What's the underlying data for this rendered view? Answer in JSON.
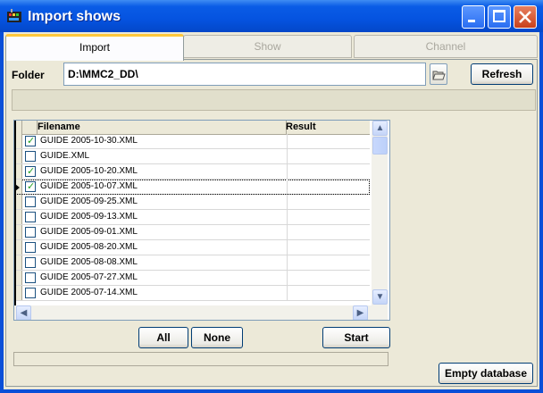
{
  "window": {
    "title": "Import shows"
  },
  "tabs": [
    {
      "label": "Import",
      "active": true
    },
    {
      "label": "Show",
      "active": false
    },
    {
      "label": "Channel",
      "active": false
    }
  ],
  "folder": {
    "label": "Folder",
    "value": "D:\\MMC2_DD\\",
    "refresh_label": "Refresh"
  },
  "grid": {
    "columns": [
      "Filename",
      "Result"
    ],
    "rows": [
      {
        "filename": "GUIDE 2005-10-30.XML",
        "checked": true,
        "result": ""
      },
      {
        "filename": "GUIDE.XML",
        "checked": false,
        "result": ""
      },
      {
        "filename": "GUIDE 2005-10-20.XML",
        "checked": true,
        "result": ""
      },
      {
        "filename": "GUIDE 2005-10-07.XML",
        "checked": true,
        "result": "",
        "current": true
      },
      {
        "filename": "GUIDE 2005-09-25.XML",
        "checked": false,
        "result": ""
      },
      {
        "filename": "GUIDE 2005-09-13.XML",
        "checked": false,
        "result": ""
      },
      {
        "filename": "GUIDE 2005-09-01.XML",
        "checked": false,
        "result": ""
      },
      {
        "filename": "GUIDE 2005-08-20.XML",
        "checked": false,
        "result": ""
      },
      {
        "filename": "GUIDE 2005-08-08.XML",
        "checked": false,
        "result": ""
      },
      {
        "filename": "GUIDE 2005-07-27.XML",
        "checked": false,
        "result": ""
      },
      {
        "filename": "GUIDE 2005-07-14.XML",
        "checked": false,
        "result": ""
      }
    ]
  },
  "buttons": {
    "all": "All",
    "none": "None",
    "start": "Start",
    "empty_db": "Empty database"
  },
  "colors": {
    "titlebar": "#0553e0",
    "check": "#21a121",
    "active_tab": "#ffc83c"
  }
}
